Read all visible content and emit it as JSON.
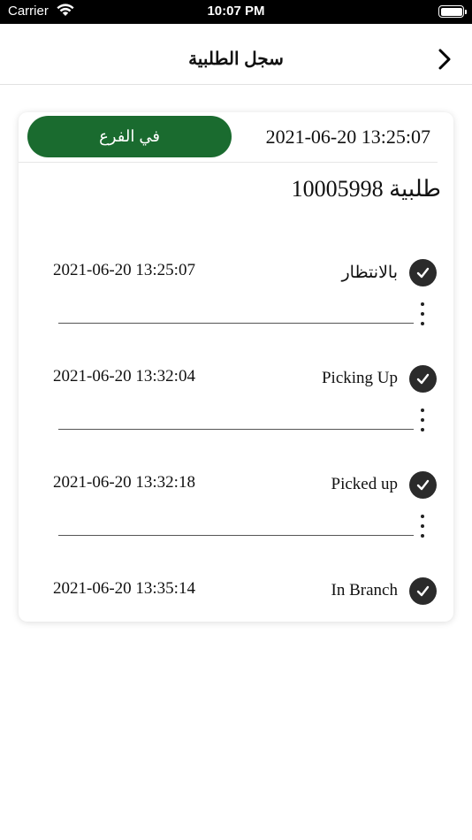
{
  "status_bar": {
    "carrier": "Carrier",
    "time": "10:07 PM"
  },
  "nav": {
    "title": "سجل الطلبية",
    "back_icon": "chevron-right-icon"
  },
  "order": {
    "status_badge": "في الفرع",
    "badge_color": "#1a6b2f",
    "datetime": "2021-06-20 13:25:07",
    "number_label": "طلبية  10005998"
  },
  "history": [
    {
      "label": "بالانتظار",
      "time": "2021-06-20 13:25:07"
    },
    {
      "label": "Picking Up",
      "time": "2021-06-20 13:32:04"
    },
    {
      "label": "Picked up",
      "time": "2021-06-20 13:32:18"
    },
    {
      "label": "In Branch",
      "time": "2021-06-20 13:35:14"
    }
  ]
}
